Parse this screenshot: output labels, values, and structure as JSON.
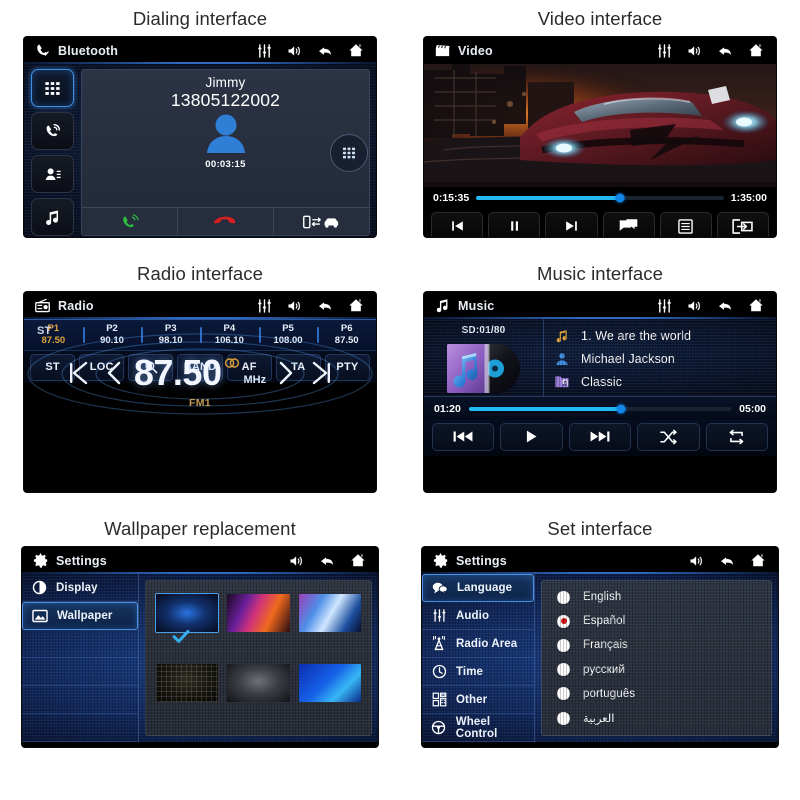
{
  "captions": {
    "dialing": "Dialing interface",
    "video": "Video interface",
    "radio": "Radio interface",
    "music": "Music interface",
    "wallpaper": "Wallpaper replacement",
    "settings": "Set interface"
  },
  "colors": {
    "accent_blue": "#2f6bc2",
    "progress_cyan": "#23b9f2",
    "knob_blue": "#1186e8",
    "preset_active": "#e0a43c",
    "band_gold": "#c49a55",
    "radio_selected_red": "#cc1111",
    "call_green": "#2bbf3e",
    "hangup_red": "#d81f1f"
  },
  "bluetooth": {
    "title": "Bluetooth",
    "title_icon": "phone-call-icon",
    "header_icons": [
      "phone-call-icon",
      "equalizer-icon",
      "volume-icon",
      "back-arrow-icon",
      "home-icon"
    ],
    "rail": [
      {
        "name": "keypad-icon",
        "selected": true
      },
      {
        "name": "call-history-icon",
        "selected": false
      },
      {
        "name": "contacts-icon",
        "selected": false
      },
      {
        "name": "music-note-icon",
        "selected": false
      }
    ],
    "contact_name": "Jimmy",
    "phone_number": "13805122002",
    "call_timer": "00:03:15",
    "actions": [
      "answer-call-icon",
      "end-call-icon",
      "transfer-audio-icon"
    ],
    "dial_pad_button": "keypad-icon"
  },
  "video": {
    "title": "Video",
    "title_icon": "film-clapper-icon",
    "header_icons": [
      "equalizer-icon",
      "volume-icon",
      "back-arrow-icon",
      "home-icon"
    ],
    "elapsed": "0:15:35",
    "duration": "1:35:00",
    "progress_percent": 58,
    "controls": [
      "previous-track-icon",
      "pause-icon",
      "next-track-icon",
      "subtitle-icon",
      "playlist-icon",
      "screen-share-icon"
    ]
  },
  "radio": {
    "title": "Radio",
    "title_icon": "radio-icon",
    "header_icons": [
      "equalizer-icon",
      "volume-icon",
      "back-arrow-icon",
      "home-icon"
    ],
    "stereo_label": "ST",
    "frequency": "87.50",
    "unit": "MHz",
    "band": "FM1",
    "stereo_icon": "stereo-rings-icon",
    "tuning_icons": [
      "seek-prev-icon",
      "step-prev-icon",
      "step-next-icon",
      "seek-next-icon"
    ],
    "presets": [
      {
        "name": "P1",
        "value": "87.50",
        "active": true
      },
      {
        "name": "P2",
        "value": "90.10",
        "active": false
      },
      {
        "name": "P3",
        "value": "98.10",
        "active": false
      },
      {
        "name": "P4",
        "value": "106.10",
        "active": false
      },
      {
        "name": "P5",
        "value": "108.00",
        "active": false
      },
      {
        "name": "P6",
        "value": "87.50",
        "active": false
      }
    ],
    "keys": [
      {
        "label": "ST",
        "icon": null
      },
      {
        "label": "LOC",
        "icon": null
      },
      {
        "label": "",
        "icon": "search-icon"
      },
      {
        "label": "BAND",
        "icon": null
      },
      {
        "label": "AF",
        "icon": null
      },
      {
        "label": "TA",
        "icon": null
      },
      {
        "label": "PTY",
        "icon": null
      }
    ]
  },
  "music": {
    "title": "Music",
    "title_icon": "music-note-icon",
    "header_icons": [
      "equalizer-icon",
      "volume-icon",
      "back-arrow-icon",
      "home-icon"
    ],
    "source": "SD:01/80",
    "album_art": "music-note-disc-art",
    "track": "1.  We are the world",
    "artist": "Michael Jackson",
    "genre": "Classic",
    "track_icon": "music-note-icon",
    "artist_icon": "person-icon",
    "genre_icon": "folder-music-icon",
    "elapsed": "01:20",
    "duration": "05:00",
    "progress_percent": 58,
    "controls": [
      "previous-track-icon",
      "play-icon",
      "next-track-icon",
      "shuffle-icon",
      "repeat-icon"
    ]
  },
  "wallpaper": {
    "title": "Settings",
    "title_icon": "gear-icon",
    "header_icons": [
      "volume-icon",
      "back-arrow-icon",
      "home-icon"
    ],
    "rail": [
      {
        "label": "Display",
        "icon": "contrast-icon",
        "selected": false
      },
      {
        "label": "Wallpaper",
        "icon": "image-icon",
        "selected": true
      },
      {
        "label": "",
        "icon": null,
        "selected": false
      },
      {
        "label": "",
        "icon": null,
        "selected": false
      },
      {
        "label": "",
        "icon": null,
        "selected": false
      },
      {
        "label": "",
        "icon": null,
        "selected": false
      }
    ],
    "thumbnails": [
      {
        "name": "wallpaper-blue-glow",
        "selected": true
      },
      {
        "name": "wallpaper-colorful-waves",
        "selected": false
      },
      {
        "name": "wallpaper-light-blue-burst",
        "selected": false
      },
      {
        "name": "wallpaper-dark-grid",
        "selected": false
      },
      {
        "name": "wallpaper-grey-gradient",
        "selected": false
      },
      {
        "name": "wallpaper-blue-curves",
        "selected": false
      }
    ],
    "check_icon": "checkmark-icon"
  },
  "settings": {
    "title": "Settings",
    "title_icon": "gear-icon",
    "header_icons": [
      "volume-icon",
      "back-arrow-icon",
      "home-icon"
    ],
    "rail": [
      {
        "label": "Language",
        "icon": "speech-bubble-icon",
        "selected": true
      },
      {
        "label": "Audio",
        "icon": "equalizer-icon",
        "selected": false
      },
      {
        "label": "Radio Area",
        "icon": "antenna-icon",
        "selected": false
      },
      {
        "label": "Time",
        "icon": "clock-icon",
        "selected": false
      },
      {
        "label": "Other",
        "icon": "grid-blocks-icon",
        "selected": false
      },
      {
        "label": "Wheel Control",
        "icon": "steering-wheel-icon",
        "selected": false
      }
    ],
    "languages": [
      {
        "label": "English",
        "selected": false
      },
      {
        "label": "Español",
        "selected": true
      },
      {
        "label": "Français",
        "selected": false
      },
      {
        "label": "русский",
        "selected": false
      },
      {
        "label": "português",
        "selected": false
      },
      {
        "label": "العربية",
        "selected": false
      }
    ]
  }
}
